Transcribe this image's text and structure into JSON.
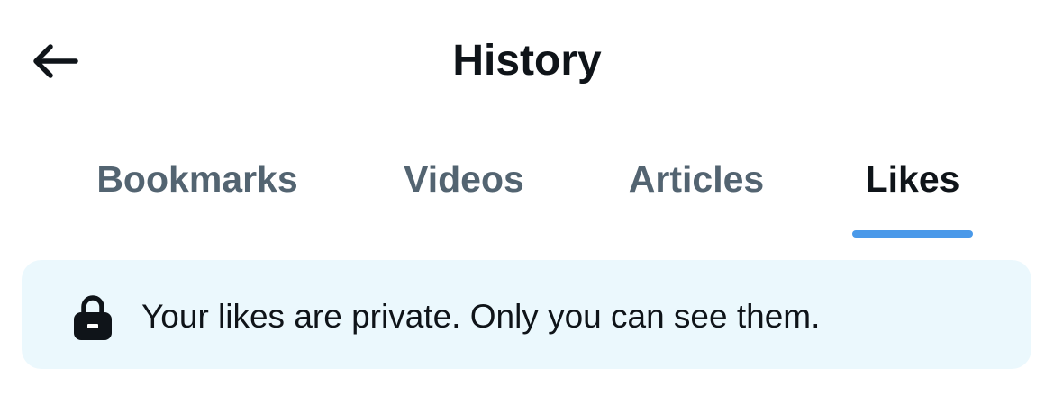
{
  "header": {
    "title": "History"
  },
  "tabs": [
    {
      "label": "Bookmarks",
      "active": false
    },
    {
      "label": "Videos",
      "active": false
    },
    {
      "label": "Articles",
      "active": false
    },
    {
      "label": "Likes",
      "active": true
    }
  ],
  "notice": {
    "icon": "lock-icon",
    "text": "Your likes are private. Only you can see them."
  },
  "colors": {
    "accent": "#4a99e9",
    "text_primary": "#0f1419",
    "text_secondary": "#536471",
    "notice_background": "#ebf8fd"
  }
}
